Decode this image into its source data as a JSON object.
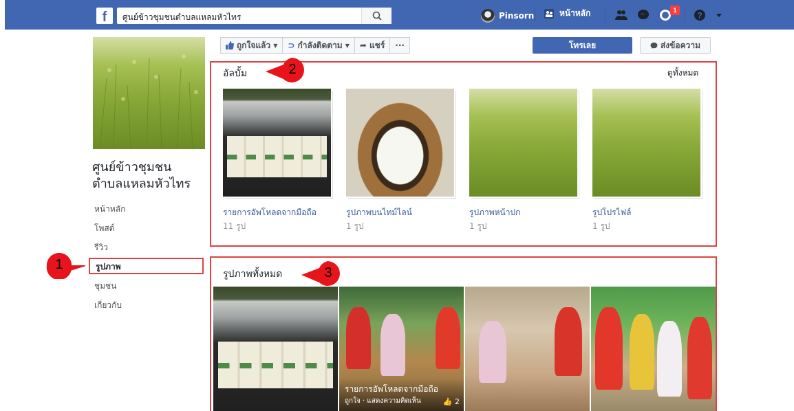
{
  "topbar": {
    "logo": "f",
    "search_value": "ศูนย์ข้าวชุมชนตำบลแหลมหัวไทร",
    "user_name": "Pinsorn",
    "home_label": "หน้าหลัก",
    "notification_count": "1",
    "icons": [
      "search-icon",
      "friends-icon",
      "messenger-icon",
      "notifications-icon",
      "help-icon",
      "dropdown-icon"
    ]
  },
  "sidebar": {
    "page_name": "ศูนย์ข้าวชุมชนตำบลแหลมหัวไทร",
    "page_name_line1": "ศูนย์ข้าวชุมชน",
    "page_name_line2": "ตำบลแหลมหัวไทร",
    "items": [
      {
        "label": "หน้าหลัก"
      },
      {
        "label": "โพสต์"
      },
      {
        "label": "รีวิว"
      },
      {
        "label": "รูปภาพ",
        "active": true
      },
      {
        "label": "ชุมชน"
      },
      {
        "label": "เกี่ยวกับ"
      }
    ]
  },
  "actions": {
    "like_label": "ถูกใจแล้ว",
    "follow_label": "กำลังติดตาม",
    "share_label": "แชร์",
    "more_label": "···",
    "call_label": "โทรเลย",
    "message_label": "ส่งข้อความ"
  },
  "callouts": [
    "1",
    "2",
    "3"
  ],
  "albums_section": {
    "title": "อัลบั้ม",
    "see_all": "ดูทั้งหมด",
    "albums": [
      {
        "name": "รายการอัพโหลดจากมือถือ",
        "count": "11 รูป"
      },
      {
        "name": "รูปภาพบนไทม์ไลน์",
        "count": "1 รูป"
      },
      {
        "name": "รูปภาพหน้าปก",
        "count": "1 รูป"
      },
      {
        "name": "รูปโปรไฟล์",
        "count": "1 รูป"
      }
    ]
  },
  "photos_section": {
    "title": "รูปภาพทั้งหมด",
    "overlay_title": "รายการอัพโหลดจากมือถือ",
    "overlay_sub": "ถูกใจ · แสดงความคิดเห็น",
    "overlay_likes": "2"
  },
  "colors": {
    "brand": "#4267b2",
    "highlight": "#e04141",
    "link": "#365899"
  }
}
